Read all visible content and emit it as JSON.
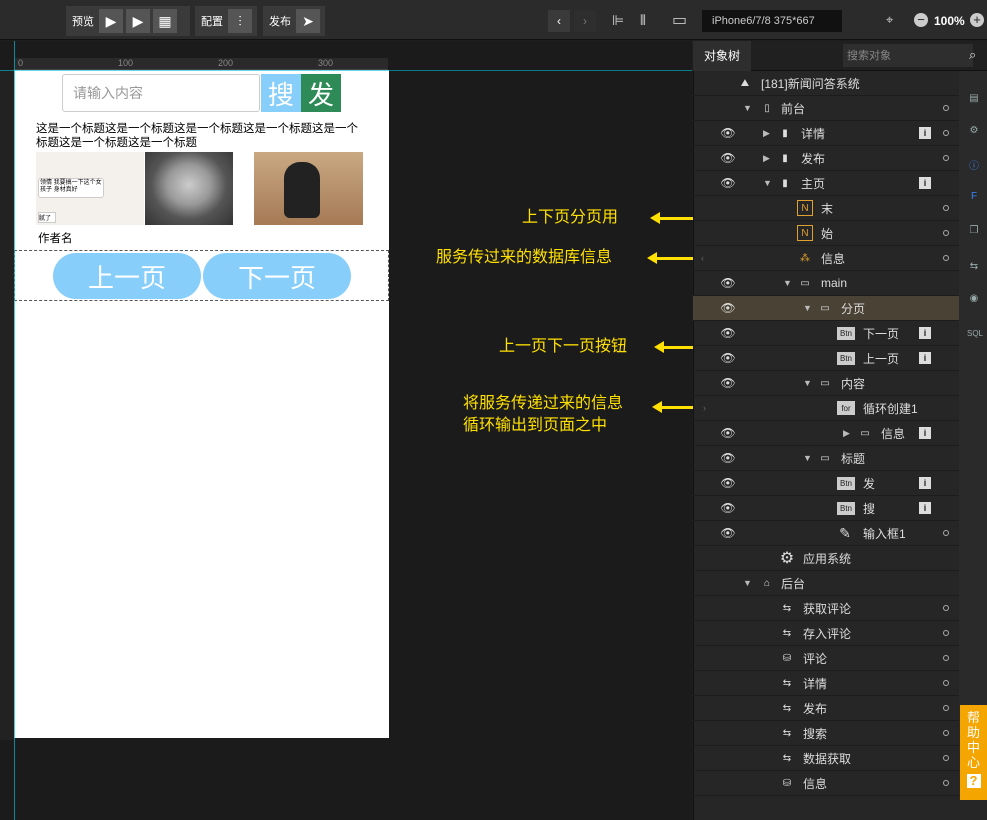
{
  "toolbar": {
    "preview": "预览",
    "config": "配置",
    "publish": "发布",
    "device": "iPhone6/7/8 375*667",
    "zoom": "100%"
  },
  "ruler": {
    "ticks": [
      "0",
      "100",
      "200",
      "300"
    ]
  },
  "phone": {
    "search_placeholder": "请输入内容",
    "search_btn": "搜",
    "publish_btn": "发",
    "news_title": "这是一个标题这是一个标题这是一个标题这是一个标题这是一个标题这是一个标题这是一个标题",
    "chat_text": "领情 我要搞一下这个女孩子 身材真好",
    "chat_text2": "腻了",
    "author": "作者名",
    "prev": "上一页",
    "next": "下一页"
  },
  "annotations": {
    "a1": "上下页分页用",
    "a2": "服务传过来的数据库信息",
    "a3": "上一页下一页按钮",
    "a4_1": "将服务传递过来的信息",
    "a4_2": "循环输出到页面之中"
  },
  "panel": {
    "tab": "对象树",
    "search_placeholder": "搜索对象"
  },
  "tree": [
    {
      "label": "[181]新闻问答系统"
    },
    {
      "label": "前台"
    },
    {
      "label": "详情"
    },
    {
      "label": "发布"
    },
    {
      "label": "主页"
    },
    {
      "label": "末"
    },
    {
      "label": "始"
    },
    {
      "label": "信息"
    },
    {
      "label": "main"
    },
    {
      "label": "分页"
    },
    {
      "label": "下一页"
    },
    {
      "label": "上一页"
    },
    {
      "label": "内容"
    },
    {
      "label": "循环创建1"
    },
    {
      "label": "信息"
    },
    {
      "label": "标题"
    },
    {
      "label": "发"
    },
    {
      "label": "搜"
    },
    {
      "label": "输入框1"
    },
    {
      "label": "应用系统"
    },
    {
      "label": "后台"
    },
    {
      "label": "获取评论"
    },
    {
      "label": "存入评论"
    },
    {
      "label": "评论"
    },
    {
      "label": "详情"
    },
    {
      "label": "发布"
    },
    {
      "label": "搜索"
    },
    {
      "label": "数据获取"
    },
    {
      "label": "信息"
    }
  ],
  "help": "帮助中心"
}
